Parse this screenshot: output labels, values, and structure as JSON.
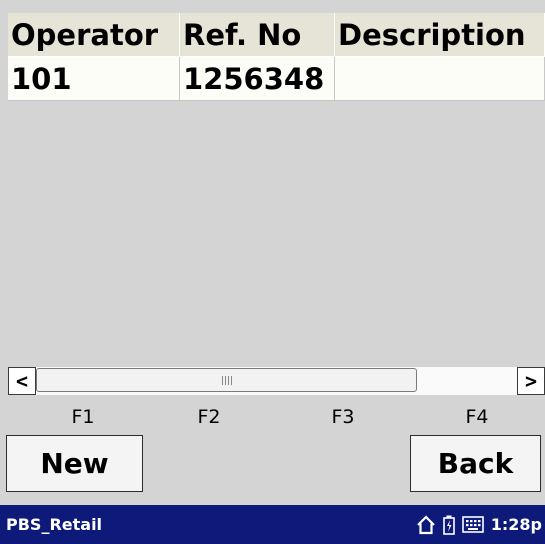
{
  "grid": {
    "columns": [
      "Operator",
      "Ref. No",
      "Description"
    ],
    "rows": [
      [
        "101",
        "1256348",
        ""
      ]
    ]
  },
  "scrollbar": {
    "left_arrow": "<",
    "right_arrow": ">"
  },
  "function_keys": [
    "F1",
    "F2",
    "F3",
    "F4"
  ],
  "buttons": {
    "new_label": "New",
    "back_label": "Back"
  },
  "taskbar": {
    "app_name": "PBS_Retail",
    "time": "1:28p",
    "icons": [
      "home-icon",
      "battery-icon",
      "keyboard-icon"
    ]
  }
}
